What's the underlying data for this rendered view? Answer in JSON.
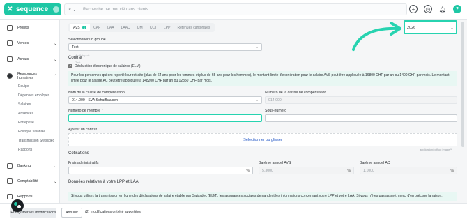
{
  "app": {
    "logo_text": "sequence",
    "search_placeholder": "Recherche par mot clé dans clients",
    "help_label": "?"
  },
  "sidebar": {
    "items": [
      {
        "label": "Projets"
      },
      {
        "label": "Ventes"
      },
      {
        "label": "Achats"
      },
      {
        "label": "Ressources humaines"
      },
      {
        "label": "Banking"
      },
      {
        "label": "Comptabilité"
      },
      {
        "label": "Rapports"
      }
    ],
    "subitems": [
      "Équipe",
      "Dépenses employés",
      "Salaires",
      "Absences",
      "Entreprise",
      "Politique salariale",
      "Transmission Swissdec",
      "Rapports"
    ]
  },
  "tabs": [
    {
      "label": "AVS",
      "count": "1"
    },
    {
      "label": "CAF"
    },
    {
      "label": "LAA"
    },
    {
      "label": "LAAC"
    },
    {
      "label": "IJM"
    },
    {
      "label": "CCT"
    },
    {
      "label": "LPP"
    },
    {
      "label": "Retenues cantonales"
    }
  ],
  "year": "2026",
  "group": {
    "label": "Sélectionner un groupe",
    "value": "Test"
  },
  "contract_title": "Contrat",
  "elm_checkbox": {
    "label": "Déclaration électronique de salaires (ELM)",
    "checked": true
  },
  "ghost_labels": {
    "a": "Actif depuis",
    "b": "Test"
  },
  "info_text": "Pour les personnes qui ont reporté leur retraite (plus de 64 ans pour les femmes et plus de 65 ans pour les hommes), le montant limite d'exonération pour le salaire AVS peut être appliquée à 16800 CHF par an ou 1400 CHF par mois. Le montant limite pour le salaire AC peut être appliquée à 148200 CHF par an ou 12350 CHF par mois.",
  "fund": {
    "name_label": "Nom de la caisse de compensation",
    "name_value": "014.000 - SVA Schaffhausen",
    "number_label": "Numéro de la caisse de compensation",
    "number_value": "014.000"
  },
  "member": {
    "label": "Numéro de membre *",
    "value": "",
    "sub_label": "Sous-numéro",
    "sub_value": ""
  },
  "add_contract": {
    "label": "Ajouter un contrat",
    "upload_text": "Sélectionner ou glisser",
    "hint": "application/pdf ou image/*"
  },
  "cotisations": {
    "title": "Cotisations",
    "admin_label": "Frais administratifs",
    "admin_value": "",
    "avs_label": "Barème annuel AVS",
    "avs_value": "5,3000",
    "ac_label": "Barème annuel AC",
    "ac_value": "1,1000",
    "unit": "%"
  },
  "lpp_section": {
    "title": "Données relatives à votre LPP et LAA",
    "info": "Si vous utilisez la transmission en ligne des déclarations de salaire établie par Swissdec (ELM), les assurances sociales demandent les informations concernant votre LPP et votre LAA. Si vous n'êtes pas assuré, merci d'en préciser la raison."
  },
  "footer": {
    "save_label": "Enregistrer les modifications",
    "cancel_label": "Annuler",
    "mods_text": "(2) modifications ont été apportées"
  },
  "colors": {
    "accent": "#1ec7a5",
    "highlight": "#27d3b0",
    "link": "#2458c6"
  }
}
